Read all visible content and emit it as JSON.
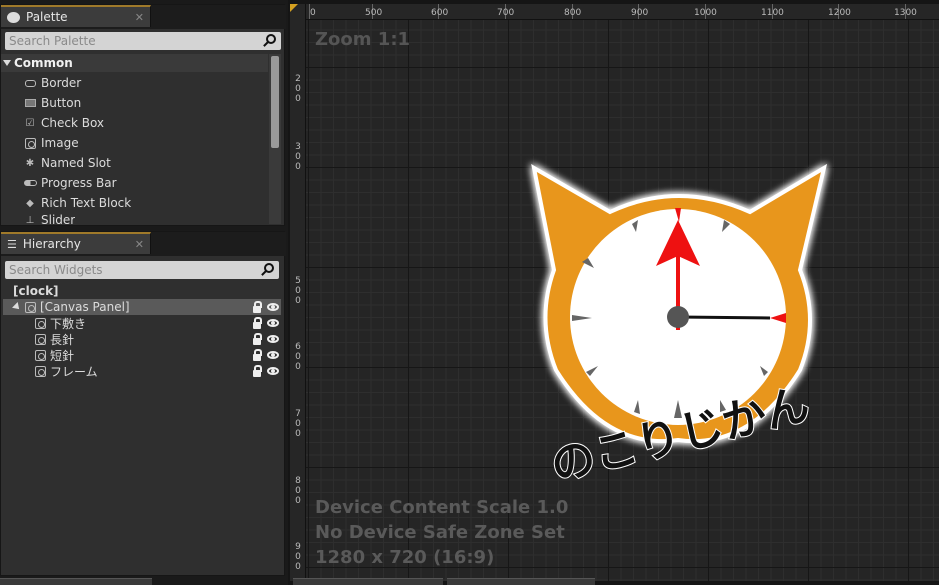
{
  "palette": {
    "tab_label": "Palette",
    "search_placeholder": "Search Palette",
    "category": "Common",
    "items": [
      {
        "label": "Border",
        "icon": "border-icon"
      },
      {
        "label": "Button",
        "icon": "button-icon"
      },
      {
        "label": "Check Box",
        "icon": "checkbox-icon"
      },
      {
        "label": "Image",
        "icon": "image-icon"
      },
      {
        "label": "Named Slot",
        "icon": "named-slot-icon"
      },
      {
        "label": "Progress Bar",
        "icon": "progress-bar-icon"
      },
      {
        "label": "Rich Text Block",
        "icon": "rich-text-icon"
      },
      {
        "label": "Slider",
        "icon": "slider-icon"
      }
    ]
  },
  "hierarchy": {
    "tab_label": "Hierarchy",
    "search_placeholder": "Search Widgets",
    "root": "[clock]",
    "canvas_panel": "[Canvas Panel]",
    "children": [
      "下敷き",
      "長針",
      "短針",
      "フレーム"
    ]
  },
  "designer": {
    "zoom": "Zoom 1:1",
    "ruler_top": [
      "0",
      "500",
      "600",
      "700",
      "800",
      "900",
      "1000",
      "1100",
      "1200",
      "1300"
    ],
    "ruler_left": [
      "2\n0\n0",
      "3\n0\n0",
      "5\n0\n0",
      "6\n0\n0",
      "7\n0\n0",
      "8\n0\n0",
      "9\n0\n0"
    ],
    "info_lines": [
      "Device Content Scale 1.0",
      "No Device Safe Zone Set",
      "1280 x 720 (16:9)"
    ],
    "clock_text": "のこりじかん"
  },
  "colors": {
    "accent": "#d4a020",
    "cat_orange": "#e8961e",
    "hand_red": "#ee1111"
  }
}
